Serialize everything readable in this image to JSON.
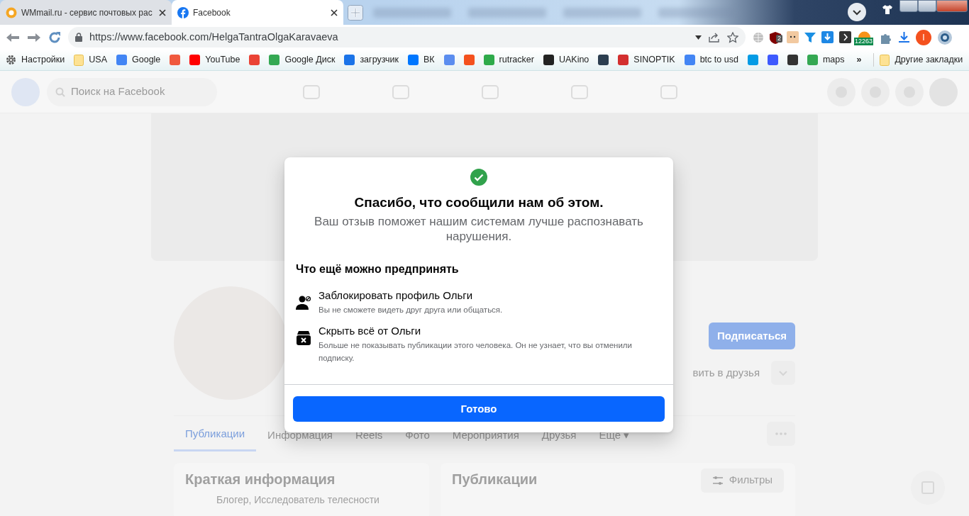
{
  "browser": {
    "tabs": [
      {
        "title": "WMmail.ru - сервис почтовых рас",
        "selected": false
      },
      {
        "title": "Facebook",
        "selected": true
      }
    ],
    "url": "https://www.facebook.com/HelgaTantraOlgaKaravaeva",
    "extension_badges": [
      "2",
      "12263"
    ],
    "profile_initial": "I",
    "bookmarks": [
      {
        "kind": "settings",
        "label": "Настройки"
      },
      {
        "kind": "folder",
        "label": "USA"
      },
      {
        "kind": "site",
        "label": "Google",
        "color": "#4285f4"
      },
      {
        "kind": "site",
        "color": "#f0593e"
      },
      {
        "kind": "site",
        "label": "YouTube",
        "color": "#ff0000"
      },
      {
        "kind": "site",
        "color": "#ea4335"
      },
      {
        "kind": "site",
        "label": "Google Диск",
        "color": "#34a853"
      },
      {
        "kind": "site",
        "label": "загрузчик",
        "color": "#1a73e8"
      },
      {
        "kind": "site",
        "label": "ВК",
        "color": "#0077ff"
      },
      {
        "kind": "site",
        "color": "#5b8def"
      },
      {
        "kind": "site",
        "color": "#f4511e"
      },
      {
        "kind": "site",
        "label": "rutracker",
        "color": "#2eaa4a"
      },
      {
        "kind": "site",
        "label": "UAKino",
        "color": "#222222"
      },
      {
        "kind": "site",
        "color": "#2c3e50"
      },
      {
        "kind": "site",
        "label": "SINOPTIK",
        "color": "#d32f2f"
      },
      {
        "kind": "site",
        "label": "btc to usd",
        "color": "#4285f4"
      },
      {
        "kind": "site",
        "color": "#039be5"
      },
      {
        "kind": "site",
        "color": "#3d5afe"
      },
      {
        "kind": "site",
        "color": "#333333"
      },
      {
        "kind": "site",
        "label": "maps",
        "color": "#34a853"
      }
    ],
    "more": "»",
    "other_bookmarks": "Другие закладки"
  },
  "page": {
    "search_placeholder": "Поиск на Facebook",
    "follow_button": "Подписаться",
    "friend_button": "вить в друзья",
    "tabs": [
      {
        "label": "Публикации",
        "selected": true
      },
      {
        "label": "Информация",
        "selected": false
      },
      {
        "label": "Reels",
        "selected": false
      },
      {
        "label": "Фото",
        "selected": false
      },
      {
        "label": "Мероприятия",
        "selected": false
      },
      {
        "label": "Друзья",
        "selected": false
      },
      {
        "label": "Ещё ▾",
        "selected": false
      }
    ],
    "intro_title": "Краткая информация",
    "intro_item": "Блогер, Исследователь телесности",
    "posts_title": "Публикации",
    "filters_button": "Фильтры"
  },
  "dialog": {
    "title": "Спасибо, что сообщили нам об этом.",
    "message": "Ваш отзыв поможет нашим системам лучше распознавать нарушения.",
    "section_title": "Что ещё можно предпринять",
    "actions": [
      {
        "kind": "block",
        "title": "Заблокировать профиль Ольги",
        "description": "Вы не сможете видеть друг друга или общаться."
      },
      {
        "kind": "hide",
        "title": "Скрыть всё от Ольги",
        "description": "Больше не показывать публикации этого человека. Он не узнает, что вы отменили подписку."
      }
    ],
    "button": "Готово"
  }
}
